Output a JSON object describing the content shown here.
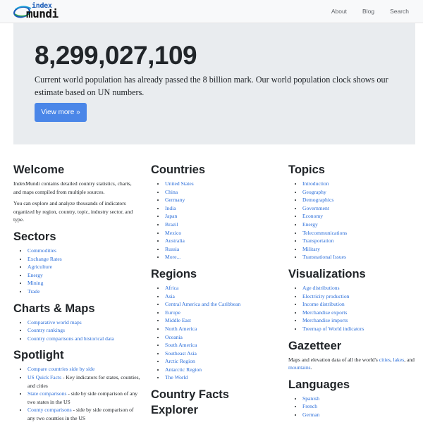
{
  "nav": {
    "logo_top": "index",
    "logo_bottom": "mundi",
    "links": [
      "About",
      "Blog",
      "Search"
    ]
  },
  "jumbo": {
    "count": "8,299,027,109",
    "text": "Current world population has already passed the 8 billion mark. Our world population clock shows our estimate based on UN numbers.",
    "button": "View more »"
  },
  "welcome": {
    "title": "Welcome",
    "p1": "IndexMundi contains detailed country statistics, charts, and maps compiled from multiple sources.",
    "p2": "You can explore and analyze thousands of indicators organized by region, country, topic, industry sector, and type."
  },
  "sectors": {
    "title": "Sectors",
    "items": [
      "Commodities",
      "Exchange Rates",
      "Agriculture",
      "Energy",
      "Mining",
      "Trade"
    ]
  },
  "charts_maps": {
    "title": "Charts & Maps",
    "items": [
      "Comparative world maps",
      "Country rankings",
      "Country comparisons and historical data"
    ]
  },
  "spotlight": {
    "title": "Spotlight",
    "items": [
      {
        "link": "Compare countries side by side",
        "desc": ""
      },
      {
        "link": "US Quick Facts",
        "desc": " - Key indicators for states, counties, and cities"
      },
      {
        "link": "State comparisons",
        "desc": " - side by side comparison of any two states in the US"
      },
      {
        "link": "County comparisons",
        "desc": " - side by side comparison of any two counties in the US"
      }
    ]
  },
  "countries": {
    "title": "Countries",
    "items": [
      "United States",
      "China",
      "Germany",
      "India",
      "Japan",
      "Brazil",
      "Mexico",
      "Australia",
      "Russia",
      "More..."
    ]
  },
  "regions": {
    "title": "Regions",
    "items": [
      "Africa",
      "Asia",
      "Central America and the Caribbean",
      "Europe",
      "Middle East",
      "North America",
      "Oceania",
      "South America",
      "Southeast Asia",
      "Arctic Region",
      "Antarctic Region",
      "The World"
    ]
  },
  "country_facts": {
    "title": "Country Facts Explorer"
  },
  "topics": {
    "title": "Topics",
    "items": [
      "Introduction",
      "Geography",
      "Demographics",
      "Government",
      "Economy",
      "Energy",
      "Telecommunications",
      "Transportation",
      "Military",
      "Transnational Issues"
    ]
  },
  "visualizations": {
    "title": "Visualizations",
    "items": [
      "Age distributions",
      "Electricity production",
      "Income distribution",
      "Merchandise exports",
      "Merchandise imports",
      "Treemap of World indicators"
    ]
  },
  "gazetteer": {
    "title": "Gazetteer",
    "pre": "Maps and elevation data of all the world's ",
    "link1": "cities",
    "sep1": ", ",
    "link2": "lakes",
    "sep2": ", and ",
    "link3": "mountains",
    "post": "."
  },
  "languages": {
    "title": "Languages",
    "items": [
      "Spanish",
      "French",
      "German"
    ]
  },
  "colors": {
    "link": "#2a6dd9",
    "button": "#4a86e8",
    "jumbo_bg": "#e9ecef"
  }
}
